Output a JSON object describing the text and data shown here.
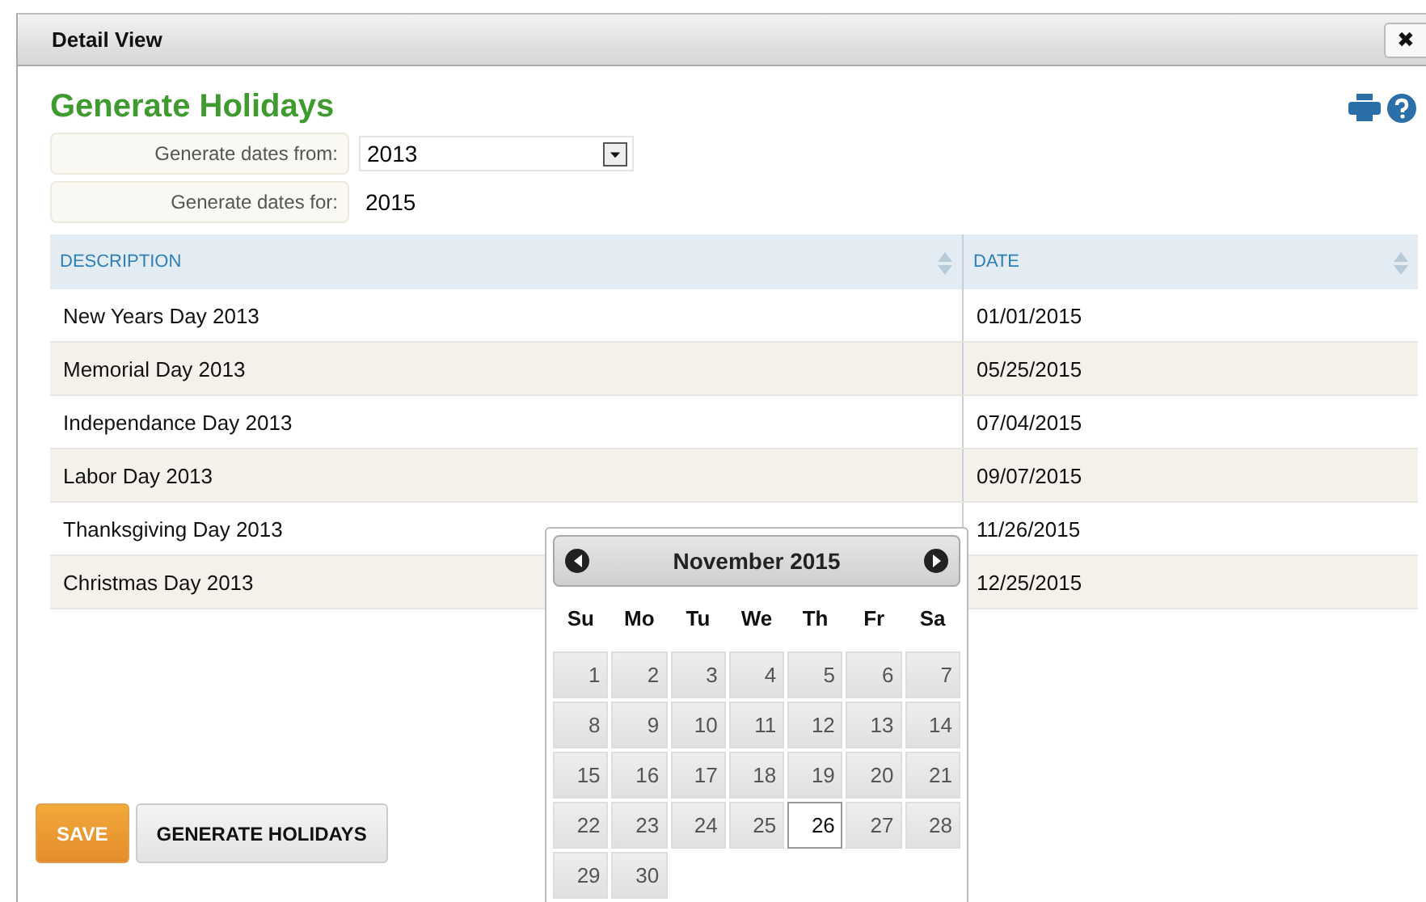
{
  "window": {
    "title": "Detail View",
    "close": "✖"
  },
  "heading": "Generate Holidays",
  "form": [
    {
      "kind": "select",
      "label": "Generate dates from:",
      "value": "2013"
    },
    {
      "kind": "text",
      "label": "Generate dates for:",
      "value": "2015"
    }
  ],
  "table": {
    "columns": [
      "DESCRIPTION",
      "DATE"
    ],
    "rows": [
      [
        "New Years Day 2013",
        "01/01/2015"
      ],
      [
        "Memorial Day 2013",
        "05/25/2015"
      ],
      [
        "Independance Day 2013",
        "07/04/2015"
      ],
      [
        "Labor Day 2013",
        "09/07/2015"
      ],
      [
        "Thanksgiving Day 2013",
        "11/26/2015"
      ],
      [
        "Christmas Day 2013",
        "12/25/2015"
      ]
    ]
  },
  "datepicker": {
    "title": "November 2015",
    "weekdays": [
      "Su",
      "Mo",
      "Tu",
      "We",
      "Th",
      "Fr",
      "Sa"
    ],
    "days": [
      {
        "label": "1",
        "selected": false
      },
      {
        "label": "2",
        "selected": false
      },
      {
        "label": "3",
        "selected": false
      },
      {
        "label": "4",
        "selected": false
      },
      {
        "label": "5",
        "selected": false
      },
      {
        "label": "6",
        "selected": false
      },
      {
        "label": "7",
        "selected": false
      },
      {
        "label": "8",
        "selected": false
      },
      {
        "label": "9",
        "selected": false
      },
      {
        "label": "10",
        "selected": false
      },
      {
        "label": "11",
        "selected": false
      },
      {
        "label": "12",
        "selected": false
      },
      {
        "label": "13",
        "selected": false
      },
      {
        "label": "14",
        "selected": false
      },
      {
        "label": "15",
        "selected": false
      },
      {
        "label": "16",
        "selected": false
      },
      {
        "label": "17",
        "selected": false
      },
      {
        "label": "18",
        "selected": false
      },
      {
        "label": "19",
        "selected": false
      },
      {
        "label": "20",
        "selected": false
      },
      {
        "label": "21",
        "selected": false
      },
      {
        "label": "22",
        "selected": false
      },
      {
        "label": "23",
        "selected": false
      },
      {
        "label": "24",
        "selected": false
      },
      {
        "label": "25",
        "selected": false
      },
      {
        "label": "26",
        "selected": true
      },
      {
        "label": "27",
        "selected": false
      },
      {
        "label": "28",
        "selected": false
      },
      {
        "label": "29",
        "selected": false
      },
      {
        "label": "30",
        "selected": false
      }
    ]
  },
  "buttons": [
    {
      "kind": "primary",
      "label": "SAVE"
    },
    {
      "kind": "secondary",
      "label": "GENERATE HOLIDAYS"
    }
  ]
}
